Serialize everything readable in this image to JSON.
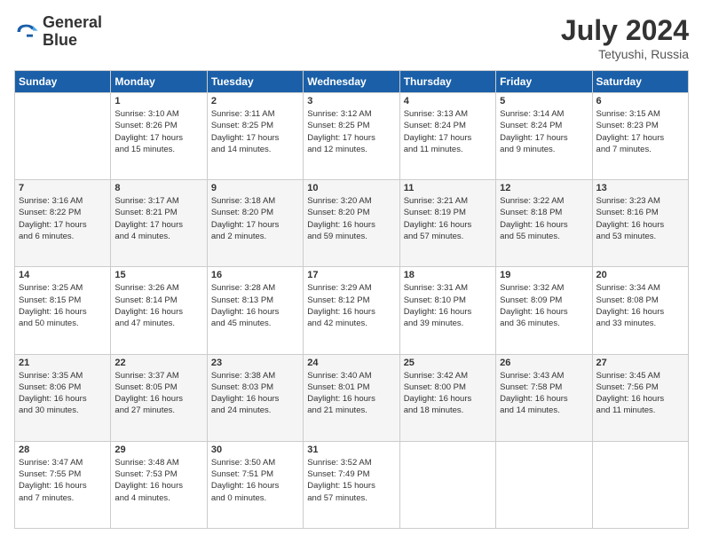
{
  "header": {
    "logo_line1": "General",
    "logo_line2": "Blue",
    "month_year": "July 2024",
    "location": "Tetyushi, Russia"
  },
  "days_of_week": [
    "Sunday",
    "Monday",
    "Tuesday",
    "Wednesday",
    "Thursday",
    "Friday",
    "Saturday"
  ],
  "weeks": [
    [
      {
        "day": "",
        "info": ""
      },
      {
        "day": "1",
        "info": "Sunrise: 3:10 AM\nSunset: 8:26 PM\nDaylight: 17 hours\nand 15 minutes."
      },
      {
        "day": "2",
        "info": "Sunrise: 3:11 AM\nSunset: 8:25 PM\nDaylight: 17 hours\nand 14 minutes."
      },
      {
        "day": "3",
        "info": "Sunrise: 3:12 AM\nSunset: 8:25 PM\nDaylight: 17 hours\nand 12 minutes."
      },
      {
        "day": "4",
        "info": "Sunrise: 3:13 AM\nSunset: 8:24 PM\nDaylight: 17 hours\nand 11 minutes."
      },
      {
        "day": "5",
        "info": "Sunrise: 3:14 AM\nSunset: 8:24 PM\nDaylight: 17 hours\nand 9 minutes."
      },
      {
        "day": "6",
        "info": "Sunrise: 3:15 AM\nSunset: 8:23 PM\nDaylight: 17 hours\nand 7 minutes."
      }
    ],
    [
      {
        "day": "7",
        "info": "Sunrise: 3:16 AM\nSunset: 8:22 PM\nDaylight: 17 hours\nand 6 minutes."
      },
      {
        "day": "8",
        "info": "Sunrise: 3:17 AM\nSunset: 8:21 PM\nDaylight: 17 hours\nand 4 minutes."
      },
      {
        "day": "9",
        "info": "Sunrise: 3:18 AM\nSunset: 8:20 PM\nDaylight: 17 hours\nand 2 minutes."
      },
      {
        "day": "10",
        "info": "Sunrise: 3:20 AM\nSunset: 8:20 PM\nDaylight: 16 hours\nand 59 minutes."
      },
      {
        "day": "11",
        "info": "Sunrise: 3:21 AM\nSunset: 8:19 PM\nDaylight: 16 hours\nand 57 minutes."
      },
      {
        "day": "12",
        "info": "Sunrise: 3:22 AM\nSunset: 8:18 PM\nDaylight: 16 hours\nand 55 minutes."
      },
      {
        "day": "13",
        "info": "Sunrise: 3:23 AM\nSunset: 8:16 PM\nDaylight: 16 hours\nand 53 minutes."
      }
    ],
    [
      {
        "day": "14",
        "info": "Sunrise: 3:25 AM\nSunset: 8:15 PM\nDaylight: 16 hours\nand 50 minutes."
      },
      {
        "day": "15",
        "info": "Sunrise: 3:26 AM\nSunset: 8:14 PM\nDaylight: 16 hours\nand 47 minutes."
      },
      {
        "day": "16",
        "info": "Sunrise: 3:28 AM\nSunset: 8:13 PM\nDaylight: 16 hours\nand 45 minutes."
      },
      {
        "day": "17",
        "info": "Sunrise: 3:29 AM\nSunset: 8:12 PM\nDaylight: 16 hours\nand 42 minutes."
      },
      {
        "day": "18",
        "info": "Sunrise: 3:31 AM\nSunset: 8:10 PM\nDaylight: 16 hours\nand 39 minutes."
      },
      {
        "day": "19",
        "info": "Sunrise: 3:32 AM\nSunset: 8:09 PM\nDaylight: 16 hours\nand 36 minutes."
      },
      {
        "day": "20",
        "info": "Sunrise: 3:34 AM\nSunset: 8:08 PM\nDaylight: 16 hours\nand 33 minutes."
      }
    ],
    [
      {
        "day": "21",
        "info": "Sunrise: 3:35 AM\nSunset: 8:06 PM\nDaylight: 16 hours\nand 30 minutes."
      },
      {
        "day": "22",
        "info": "Sunrise: 3:37 AM\nSunset: 8:05 PM\nDaylight: 16 hours\nand 27 minutes."
      },
      {
        "day": "23",
        "info": "Sunrise: 3:38 AM\nSunset: 8:03 PM\nDaylight: 16 hours\nand 24 minutes."
      },
      {
        "day": "24",
        "info": "Sunrise: 3:40 AM\nSunset: 8:01 PM\nDaylight: 16 hours\nand 21 minutes."
      },
      {
        "day": "25",
        "info": "Sunrise: 3:42 AM\nSunset: 8:00 PM\nDaylight: 16 hours\nand 18 minutes."
      },
      {
        "day": "26",
        "info": "Sunrise: 3:43 AM\nSunset: 7:58 PM\nDaylight: 16 hours\nand 14 minutes."
      },
      {
        "day": "27",
        "info": "Sunrise: 3:45 AM\nSunset: 7:56 PM\nDaylight: 16 hours\nand 11 minutes."
      }
    ],
    [
      {
        "day": "28",
        "info": "Sunrise: 3:47 AM\nSunset: 7:55 PM\nDaylight: 16 hours\nand 7 minutes."
      },
      {
        "day": "29",
        "info": "Sunrise: 3:48 AM\nSunset: 7:53 PM\nDaylight: 16 hours\nand 4 minutes."
      },
      {
        "day": "30",
        "info": "Sunrise: 3:50 AM\nSunset: 7:51 PM\nDaylight: 16 hours\nand 0 minutes."
      },
      {
        "day": "31",
        "info": "Sunrise: 3:52 AM\nSunset: 7:49 PM\nDaylight: 15 hours\nand 57 minutes."
      },
      {
        "day": "",
        "info": ""
      },
      {
        "day": "",
        "info": ""
      },
      {
        "day": "",
        "info": ""
      }
    ]
  ]
}
